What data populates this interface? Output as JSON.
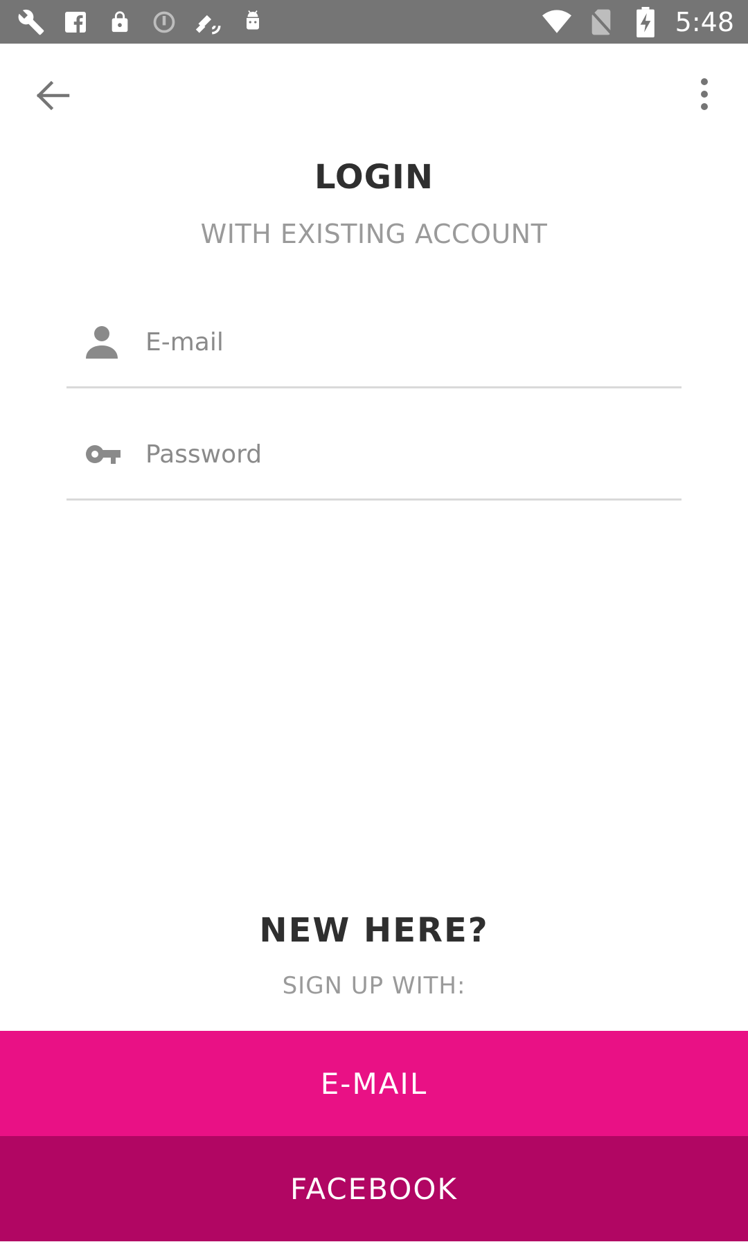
{
  "status_bar": {
    "time": "5:48",
    "left_icons": [
      "wrench-icon",
      "facebook-icon",
      "lock-icon",
      "circle-icon",
      "satellite-icon",
      "android-icon"
    ],
    "right_icons": [
      "wifi-icon",
      "no-sim-icon",
      "battery-charging-icon"
    ]
  },
  "action_bar": {
    "back_icon": "back-arrow-icon",
    "menu_icon": "more-vert-icon"
  },
  "login": {
    "title": "LOGIN",
    "subtitle": "WITH EXISTING ACCOUNT"
  },
  "form": {
    "email_placeholder": "E-mail",
    "email_icon": "person-icon",
    "password_placeholder": "Password",
    "password_icon": "key-icon"
  },
  "signup": {
    "title": "NEW HERE?",
    "subtitle": "SIGN UP WITH:",
    "email_button": "E-MAIL",
    "facebook_button": "FACEBOOK"
  },
  "colors": {
    "status_bar": "#757575",
    "email_button": "#e91185",
    "facebook_button": "#b10663",
    "heading": "#2f2f2f",
    "muted_text": "#9a9a9a"
  }
}
